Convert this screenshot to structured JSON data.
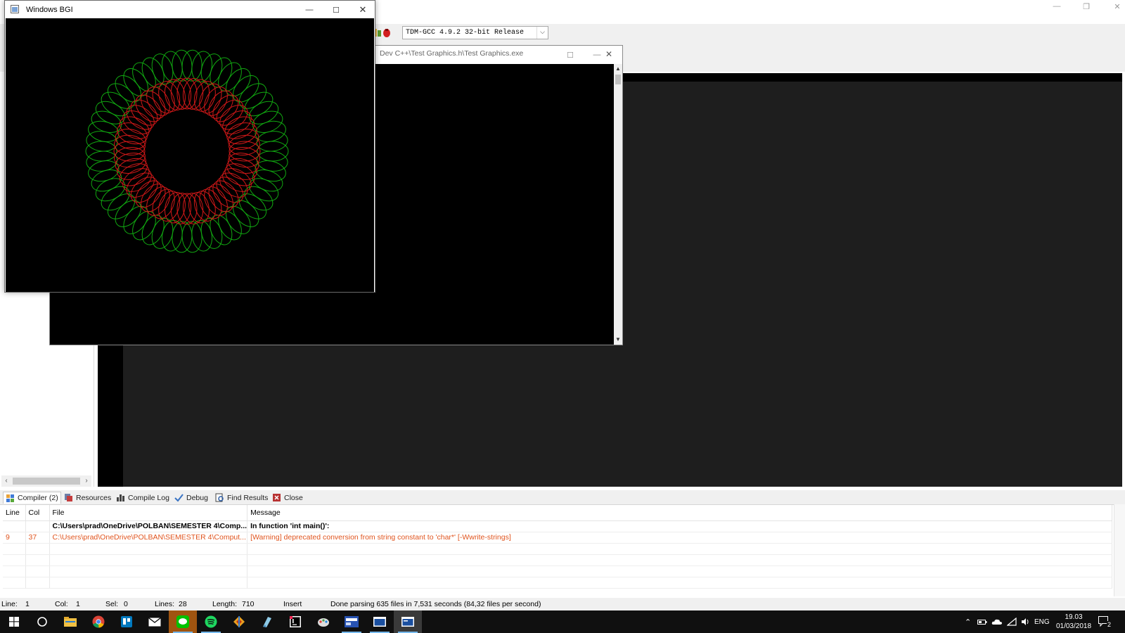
{
  "ide": {
    "compiler_select": "TDM-GCC 4.9.2 32-bit Release"
  },
  "bgi_window": {
    "title": "Windows BGI"
  },
  "console_window": {
    "title": "Dev C++\\Test Graphics.h\\Test Graphics.exe"
  },
  "bottom_tabs": [
    {
      "label": "Compiler (2)"
    },
    {
      "label": "Resources"
    },
    {
      "label": "Compile Log"
    },
    {
      "label": "Debug"
    },
    {
      "label": "Find Results"
    },
    {
      "label": "Close"
    }
  ],
  "messages": {
    "headers": {
      "line": "Line",
      "col": "Col",
      "file": "File",
      "message": "Message"
    },
    "rows": [
      {
        "line": "",
        "col": "",
        "file": "C:\\Users\\prad\\OneDrive\\POLBAN\\SEMESTER 4\\Comp...",
        "message": "In function 'int main()':"
      },
      {
        "line": "9",
        "col": "37",
        "file": "C:\\Users\\prad\\OneDrive\\POLBAN\\SEMESTER 4\\Comput...",
        "message": "[Warning] deprecated conversion from string constant to 'char*' [-Wwrite-strings]"
      }
    ]
  },
  "statusbar": {
    "line_label": "Line:",
    "line_value": "1",
    "col_label": "Col:",
    "col_value": "1",
    "sel_label": "Sel:",
    "sel_value": "0",
    "lines_label": "Lines:",
    "lines_value": "28",
    "length_label": "Length:",
    "length_value": "710",
    "mode": "Insert",
    "parse_status": "Done parsing 635 files in 7,531 seconds (84,32 files per second)"
  },
  "taskbar": {
    "apps": [
      "start-icon",
      "cortana-icon",
      "file-explorer-icon",
      "chrome-icon",
      "trello-icon",
      "mail-icon",
      "line-icon",
      "spotify-icon",
      "office-lens-icon",
      "notepad-icon",
      "intellij-icon",
      "paint-icon",
      "devcpp-icon",
      "window-icon",
      "console-icon"
    ],
    "language": "ENG",
    "time": "19.03",
    "date": "01/03/2018",
    "notifications": "2"
  },
  "colors": {
    "outer_ring": "#11a811",
    "inner_ring": "#d01818",
    "warning": "#e0541e"
  }
}
